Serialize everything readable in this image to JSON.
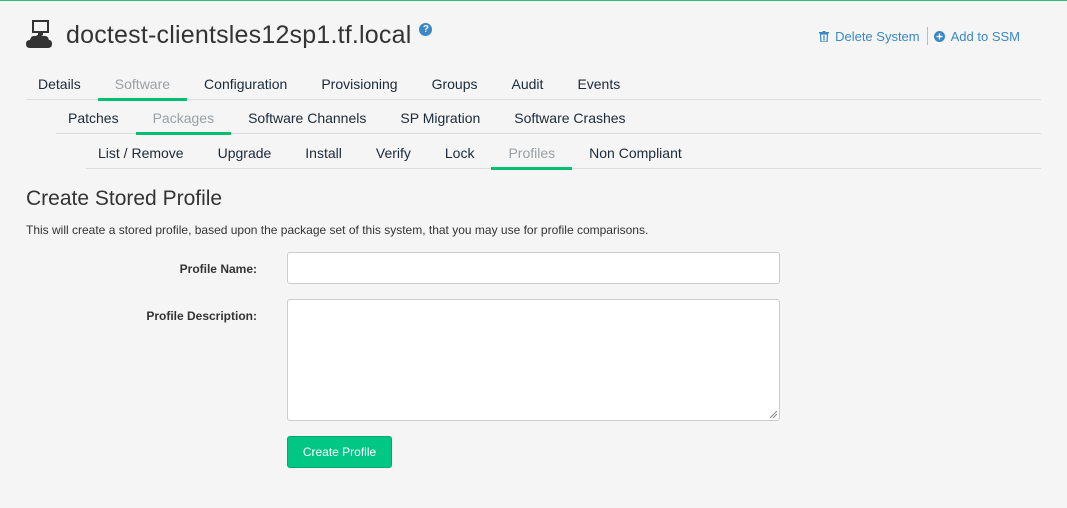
{
  "system": {
    "title": "doctest-clientsles12sp1.tf.local",
    "help_icon": "question-circle-icon"
  },
  "actions": {
    "delete_label": "Delete System",
    "add_label": "Add to SSM"
  },
  "tabs_level1": [
    {
      "label": "Details"
    },
    {
      "label": "Software",
      "active": true
    },
    {
      "label": "Configuration"
    },
    {
      "label": "Provisioning"
    },
    {
      "label": "Groups"
    },
    {
      "label": "Audit"
    },
    {
      "label": "Events"
    }
  ],
  "tabs_level2": [
    {
      "label": "Patches"
    },
    {
      "label": "Packages",
      "active": true
    },
    {
      "label": "Software Channels"
    },
    {
      "label": "SP Migration"
    },
    {
      "label": "Software Crashes"
    }
  ],
  "tabs_level3": [
    {
      "label": "List / Remove"
    },
    {
      "label": "Upgrade"
    },
    {
      "label": "Install"
    },
    {
      "label": "Verify"
    },
    {
      "label": "Lock"
    },
    {
      "label": "Profiles",
      "active": true
    },
    {
      "label": "Non Compliant"
    }
  ],
  "form": {
    "heading": "Create Stored Profile",
    "description": "This will create a stored profile, based upon the package set of this system, that you may use for profile comparisons.",
    "name_label": "Profile Name:",
    "name_value": "",
    "desc_label": "Profile Description:",
    "desc_value": "",
    "submit_label": "Create Profile"
  },
  "colors": {
    "accent": "#00bf6f",
    "link": "#3a88c6",
    "button": "#00c784"
  }
}
